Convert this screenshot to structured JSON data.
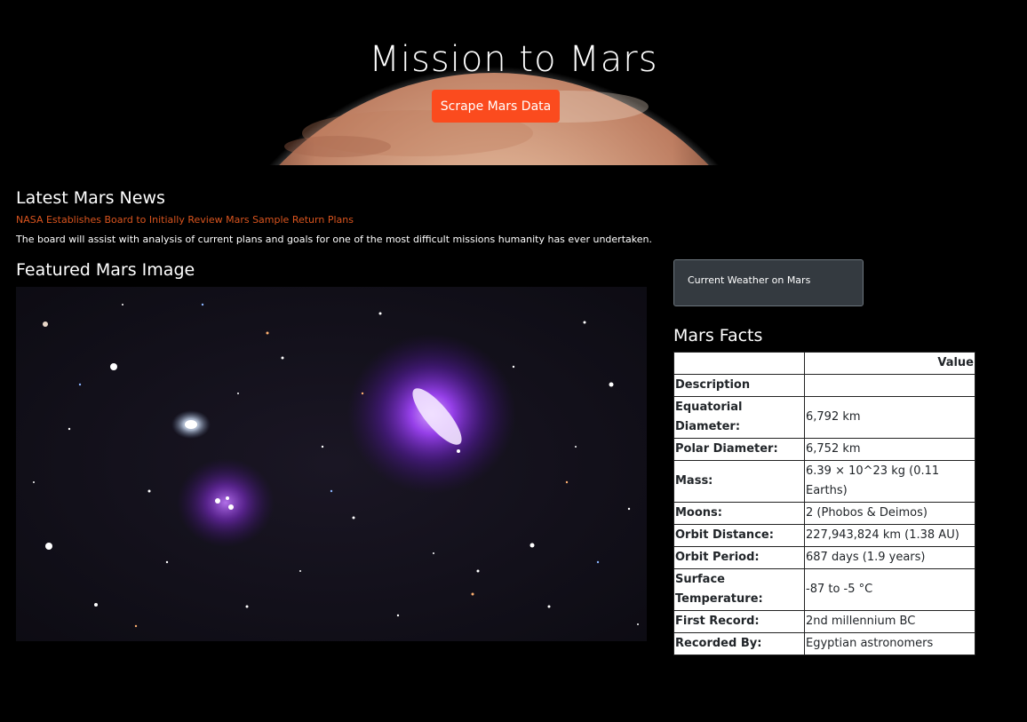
{
  "hero": {
    "title": "Mission to Mars",
    "scrape_button_label": "Scrape Mars Data"
  },
  "news": {
    "heading": "Latest Mars News",
    "headline": "NASA Establishes Board to Initially Review Mars Sample Return Plans",
    "teaser": "The board will assist with analysis of current plans and goals for one of the most difficult missions humanity has ever undertaken."
  },
  "featured": {
    "heading": "Featured Mars Image"
  },
  "weather": {
    "label": "Current Weather on Mars"
  },
  "facts": {
    "heading": "Mars Facts",
    "column_header": "Value",
    "index_label": "Description",
    "rows": [
      {
        "key": "Equatorial Diameter:",
        "value": "6,792 km"
      },
      {
        "key": "Polar Diameter:",
        "value": "6,752 km"
      },
      {
        "key": "Mass:",
        "value": "6.39 × 10^23 kg (0.11 Earths)"
      },
      {
        "key": "Moons:",
        "value": "2 (Phobos & Deimos)"
      },
      {
        "key": "Orbit Distance:",
        "value": "227,943,824 km (1.38 AU)"
      },
      {
        "key": "Orbit Period:",
        "value": "687 days (1.9 years)"
      },
      {
        "key": "Surface Temperature:",
        "value": "-87 to -5 °C"
      },
      {
        "key": "First Record:",
        "value": "2nd millennium BC"
      },
      {
        "key": "Recorded By:",
        "value": "Egyptian astronomers"
      }
    ]
  },
  "colors": {
    "accent": "#fb4b1e",
    "link": "#d9541e",
    "card_bg": "#343a40",
    "page_bg": "#000000"
  }
}
